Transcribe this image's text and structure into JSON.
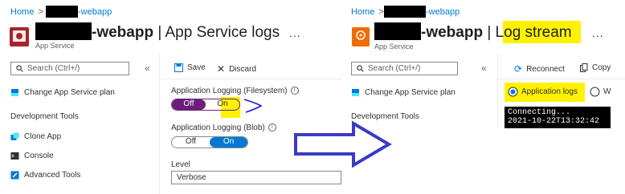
{
  "left": {
    "breadcrumb": {
      "home": "Home",
      "sep": ">",
      "resource_suffix": "-webapp"
    },
    "title": {
      "name_suffix": "-webapp",
      "section": "| App Service logs"
    },
    "subtitle": "App Service",
    "more": "...",
    "search": {
      "placeholder": "Search (Ctrl+/)"
    },
    "collapse": "«",
    "nav": {
      "change_plan": "Change App Service plan",
      "section_title": "Development Tools",
      "clone_app": "Clone App",
      "console": "Console",
      "advanced_tools": "Advanced Tools"
    },
    "toolbar": {
      "save": "Save",
      "discard": "Discard"
    },
    "logging_fs": {
      "label": "Application Logging (Filesystem)",
      "off": "Off",
      "on": "On",
      "selected": "Off"
    },
    "logging_blob": {
      "label": "Application Logging (Blob)",
      "off": "Off",
      "on": "On",
      "selected": "On"
    },
    "level": {
      "label": "Level",
      "value": "Verbose"
    }
  },
  "right": {
    "breadcrumb": {
      "home": "Home",
      "sep": ">",
      "resource_suffix": "-webapp"
    },
    "title": {
      "name_suffix": "-webapp",
      "section": "| Log stream"
    },
    "subtitle": "App Service",
    "more": "...",
    "search": {
      "placeholder": "Search (Ctrl+/)"
    },
    "collapse": "«",
    "nav": {
      "change_plan": "Change App Service plan",
      "section_title": "Development Tools"
    },
    "toolbar": {
      "reconnect": "Reconnect",
      "copy": "Copy"
    },
    "radio": {
      "application_logs": "Application logs",
      "web_partial": "W"
    },
    "console": {
      "line1": "Connecting...",
      "line2": "2021-10-22T13:32:42"
    }
  },
  "colors": {
    "accent": "#0078d4",
    "highlight": "#fff200",
    "arrow": "#3b3bc4",
    "purple_toggle": "#6b1f7a"
  },
  "icons": [
    "app-service-icon",
    "search-icon",
    "plan-icon",
    "clone-icon",
    "console-icon",
    "advanced-tools-icon",
    "save-icon",
    "discard-icon",
    "reconnect-icon",
    "copy-icon",
    "more-icon",
    "collapse-icon",
    "info-icon",
    "right-arrow-icon"
  ]
}
